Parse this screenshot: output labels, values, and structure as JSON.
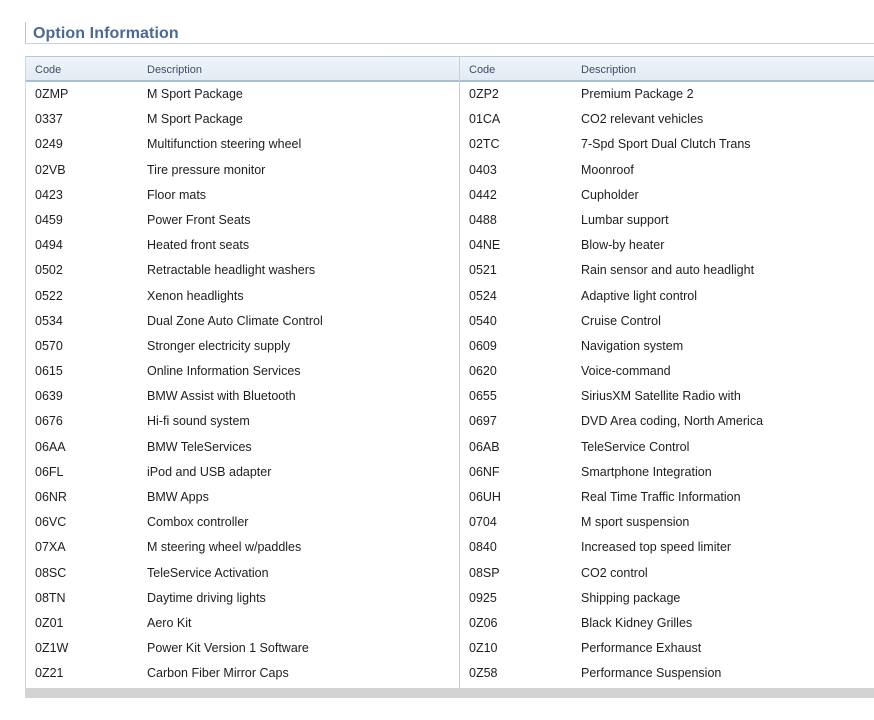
{
  "section": {
    "title": "Option Information"
  },
  "table": {
    "headers": {
      "left_code": "Code",
      "left_desc": "Description",
      "right_code": "Code",
      "right_desc": "Description"
    },
    "left": [
      {
        "code": "0ZMP",
        "desc": "M Sport Package"
      },
      {
        "code": "0337",
        "desc": "M Sport Package"
      },
      {
        "code": "0249",
        "desc": "Multifunction steering wheel"
      },
      {
        "code": "02VB",
        "desc": "Tire pressure monitor"
      },
      {
        "code": "0423",
        "desc": "Floor mats"
      },
      {
        "code": "0459",
        "desc": "Power Front Seats"
      },
      {
        "code": "0494",
        "desc": "Heated front seats"
      },
      {
        "code": "0502",
        "desc": "Retractable headlight washers"
      },
      {
        "code": "0522",
        "desc": "Xenon headlights"
      },
      {
        "code": "0534",
        "desc": "Dual Zone Auto Climate Control"
      },
      {
        "code": "0570",
        "desc": "Stronger electricity supply"
      },
      {
        "code": "0615",
        "desc": "Online Information Services"
      },
      {
        "code": "0639",
        "desc": "BMW Assist with Bluetooth"
      },
      {
        "code": "0676",
        "desc": "Hi-fi sound system"
      },
      {
        "code": "06AA",
        "desc": "BMW TeleServices"
      },
      {
        "code": "06FL",
        "desc": "iPod and USB adapter"
      },
      {
        "code": "06NR",
        "desc": "BMW Apps"
      },
      {
        "code": "06VC",
        "desc": "Combox controller"
      },
      {
        "code": "07XA",
        "desc": "M steering wheel w/paddles"
      },
      {
        "code": "08SC",
        "desc": "TeleService Activation"
      },
      {
        "code": "08TN",
        "desc": "Daytime driving lights"
      },
      {
        "code": "0Z01",
        "desc": "Aero Kit"
      },
      {
        "code": "0Z1W",
        "desc": "Power Kit Version 1 Software"
      },
      {
        "code": "0Z21",
        "desc": "Carbon Fiber Mirror Caps"
      }
    ],
    "right": [
      {
        "code": "0ZP2",
        "desc": "Premium Package 2"
      },
      {
        "code": "01CA",
        "desc": "CO2 relevant vehicles"
      },
      {
        "code": "02TC",
        "desc": "7-Spd Sport Dual Clutch Trans"
      },
      {
        "code": "0403",
        "desc": "Moonroof"
      },
      {
        "code": "0442",
        "desc": "Cupholder"
      },
      {
        "code": "0488",
        "desc": "Lumbar support"
      },
      {
        "code": "04NE",
        "desc": "Blow-by heater"
      },
      {
        "code": "0521",
        "desc": "Rain sensor and auto headlight"
      },
      {
        "code": "0524",
        "desc": "Adaptive light control"
      },
      {
        "code": "0540",
        "desc": "Cruise Control"
      },
      {
        "code": "0609",
        "desc": "Navigation system"
      },
      {
        "code": "0620",
        "desc": "Voice-command"
      },
      {
        "code": "0655",
        "desc": "SiriusXM Satellite Radio with"
      },
      {
        "code": "0697",
        "desc": "DVD Area coding, North America"
      },
      {
        "code": "06AB",
        "desc": "TeleService Control"
      },
      {
        "code": "06NF",
        "desc": "Smartphone Integration"
      },
      {
        "code": "06UH",
        "desc": "Real Time Traffic Information"
      },
      {
        "code": "0704",
        "desc": "M sport suspension"
      },
      {
        "code": "0840",
        "desc": "Increased top speed limiter"
      },
      {
        "code": "08SP",
        "desc": "CO2 control"
      },
      {
        "code": "0925",
        "desc": "Shipping package"
      },
      {
        "code": "0Z06",
        "desc": "Black Kidney Grilles"
      },
      {
        "code": "0Z10",
        "desc": "Performance Exhaust"
      },
      {
        "code": "0Z58",
        "desc": "Performance Suspension"
      }
    ]
  },
  "colors": {
    "title": "#4a6a93",
    "header_bg": "#e2eaf4",
    "header_border": "#a9bdd6",
    "text": "#1e1e1e"
  }
}
